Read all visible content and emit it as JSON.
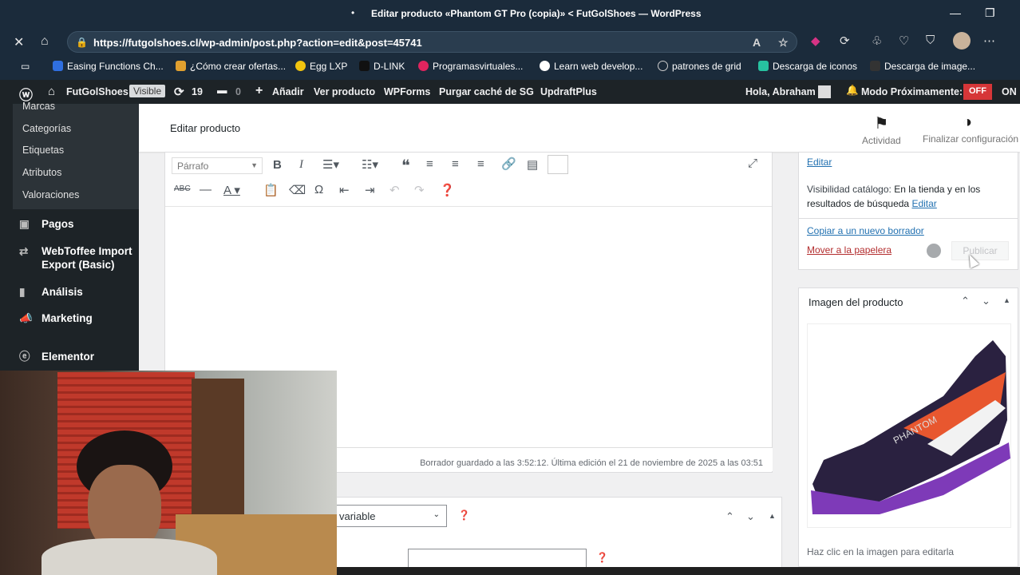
{
  "window": {
    "title": "Editar producto «Phantom GT Pro (copia)» < FutGolShoes — WordPress"
  },
  "browser": {
    "url": "https://futgolshoes.cl/wp-admin/post.php?action=edit&post=45741",
    "bookmarks": [
      "Easing Functions Ch...",
      "¿Cómo crear ofertas...",
      "Egg LXP",
      "D-LINK",
      "Programasvirtuales...",
      "Learn web develop...",
      "patrones de grid",
      "Descarga de iconos",
      "Descarga de image..."
    ]
  },
  "adminbar": {
    "site": "FutGolShoes",
    "visible_badge": "Visible",
    "updates": "19",
    "comments": "0",
    "add": "Añadir",
    "view": "Ver producto",
    "wpforms": "WPForms",
    "purge": "Purgar caché de SG",
    "updraft": "UpdraftPlus",
    "greeting": "Hola, Abraham",
    "coming_soon": "Modo Próximamente:",
    "off": "OFF",
    "on": "ON"
  },
  "sidebar": {
    "submenu": [
      "Marcas",
      "Categorías",
      "Etiquetas",
      "Atributos",
      "Valoraciones"
    ],
    "menu": [
      "Pagos",
      "WebToffee Import Export (Basic)",
      "Análisis",
      "Marketing",
      "Elementor"
    ]
  },
  "header": {
    "title": "Editar producto",
    "activity": "Actividad",
    "finish": "Finalizar configuración"
  },
  "editor": {
    "format": "Párrafo",
    "status": "Borrador guardado a las 3:52:12. Última edición el 21 de noviembre de 2025 a las 03:51"
  },
  "product_type": {
    "value": "variable"
  },
  "publish_box": {
    "edit_top": "Editar",
    "visibility_label": "Visibilidad catálogo:",
    "visibility_value": "En la tienda y en los resultados de búsqueda",
    "visibility_edit": "Editar",
    "copy": "Copiar a un nuevo borrador",
    "trash": "Mover a la papelera",
    "publish": "Publicar"
  },
  "image_box": {
    "title": "Imagen del producto",
    "hint": "Haz clic en la imagen para editarla"
  }
}
